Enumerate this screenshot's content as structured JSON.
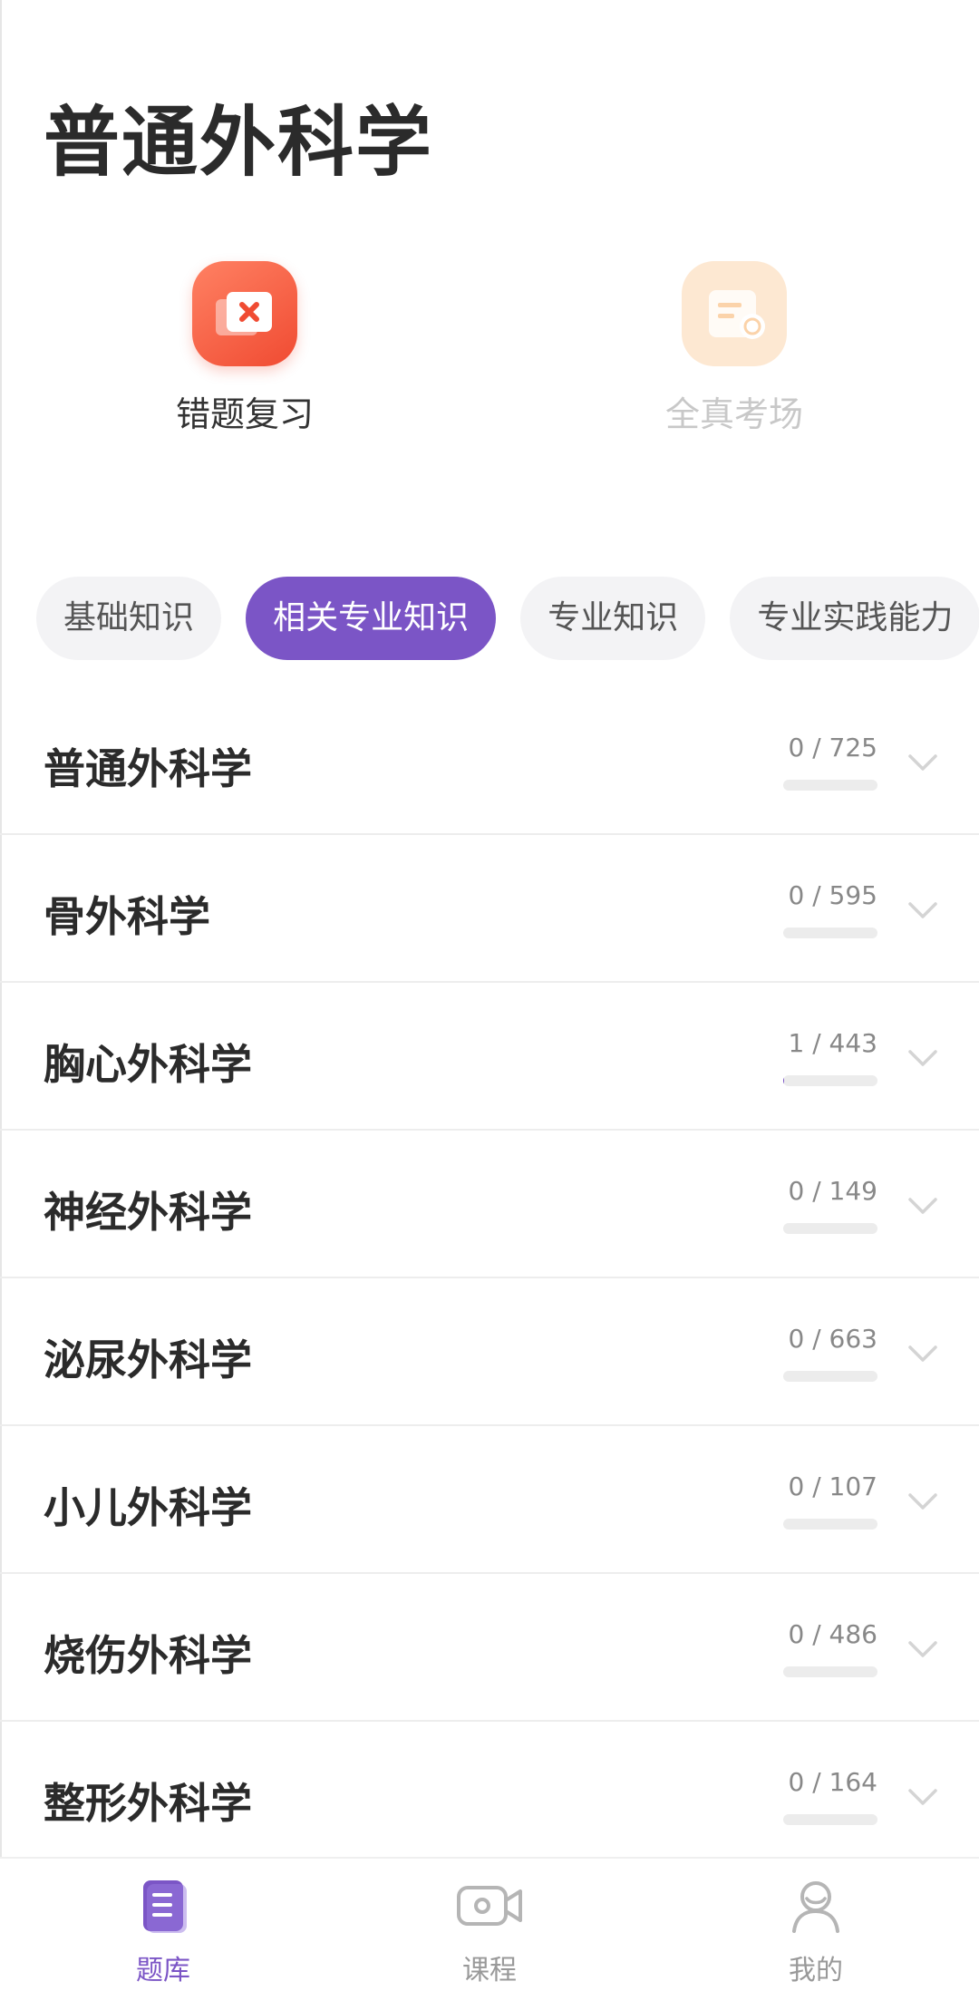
{
  "header": {
    "title": "普通外科学"
  },
  "quick_actions": [
    {
      "label": "错题复习",
      "icon": "wrong-answer-icon",
      "color": "#f04b32"
    },
    {
      "label": "全真考场",
      "icon": "exam-paper-icon",
      "color": "#fde8d2"
    }
  ],
  "tabs": [
    {
      "label": "基础知识",
      "active": false
    },
    {
      "label": "相关专业知识",
      "active": true
    },
    {
      "label": "专业知识",
      "active": false
    },
    {
      "label": "专业实践能力",
      "active": false
    }
  ],
  "subjects": [
    {
      "name": "普通外科学",
      "count": "0 / 725",
      "progress": 0
    },
    {
      "name": "骨外科学",
      "count": "0 / 595",
      "progress": 0
    },
    {
      "name": "胸心外科学",
      "count": "1 / 443",
      "progress": 0.0023
    },
    {
      "name": "神经外科学",
      "count": "0 / 149",
      "progress": 0
    },
    {
      "name": "泌尿外科学",
      "count": "0 / 663",
      "progress": 0
    },
    {
      "name": "小儿外科学",
      "count": "0 / 107",
      "progress": 0
    },
    {
      "name": "烧伤外科学",
      "count": "0 / 486",
      "progress": 0
    },
    {
      "name": "整形外科学",
      "count": "0 / 164",
      "progress": 0
    }
  ],
  "bottom_nav": [
    {
      "label": "题库",
      "icon": "question-bank-icon",
      "active": true
    },
    {
      "label": "课程",
      "icon": "video-camera-icon",
      "active": false
    },
    {
      "label": "我的",
      "icon": "user-profile-icon",
      "active": false
    }
  ],
  "colors": {
    "accent": "#7b55c6",
    "wrong_review": "#f04b32",
    "exam": "#fde8d2"
  }
}
